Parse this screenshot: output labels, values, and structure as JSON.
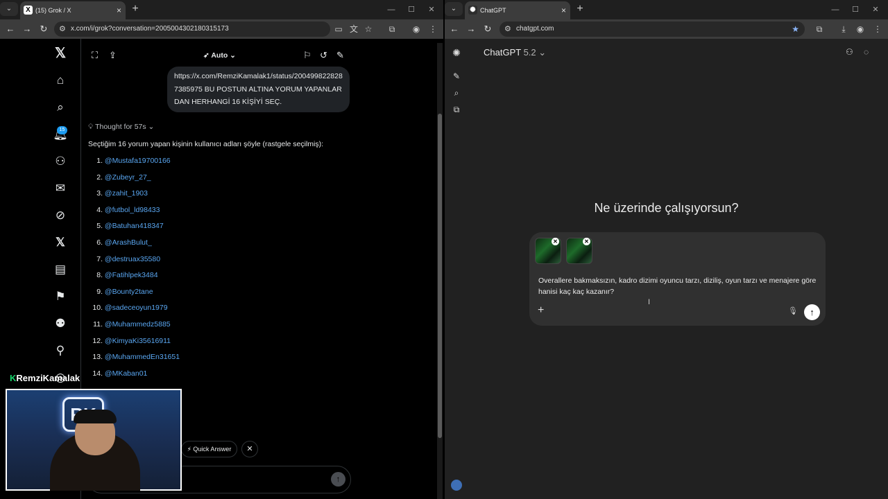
{
  "left_window": {
    "tab_title": "(15) Grok / X",
    "tab_favicon": "X",
    "url": "x.com/i/grok?conversation=2005004302180315173",
    "notification_count": "15",
    "grok": {
      "mode_label": "Auto",
      "user_message": "https://x.com/RemziKamalak1/status/2004998228287385975 BU POSTUN ALTINA YORUM YAPANLARDAN HERHANGİ 16 KİŞİYİ SEÇ.",
      "thought_label": "Thought for 57s",
      "intro": "Seçtiğim 16 yorum yapan kişinin kullanıcı adları şöyle (rastgele seçilmiş):",
      "users": [
        {
          "n": "1.",
          "handle": "@Mustafa19700166"
        },
        {
          "n": "2.",
          "handle": "@Zubeyr_27_"
        },
        {
          "n": "3.",
          "handle": "@zahit_1903"
        },
        {
          "n": "4.",
          "handle": "@futbol_ld98433"
        },
        {
          "n": "5.",
          "handle": "@Batuhan418347"
        },
        {
          "n": "6.",
          "handle": "@ArashBulut_"
        },
        {
          "n": "7.",
          "handle": "@destruax35580"
        },
        {
          "n": "8.",
          "handle": "@Fatihlpek3484"
        },
        {
          "n": "9.",
          "handle": "@Bounty2tane"
        },
        {
          "n": "10.",
          "handle": "@sadeceoyun1979"
        },
        {
          "n": "11.",
          "handle": "@Muhammedz5885"
        },
        {
          "n": "12.",
          "handle": "@KimyaKi35616911"
        },
        {
          "n": "13.",
          "handle": "@MuhammedEn31651"
        },
        {
          "n": "14.",
          "handle": "@MKaban01"
        }
      ],
      "quick_answer": "Quick Answer"
    },
    "overlay_brand_k": "K",
    "overlay_brand": "RemziKamalak"
  },
  "right_window": {
    "tab_title": "ChatGPT",
    "url": "chatgpt.com",
    "model_name": "ChatGPT",
    "model_version": "5.2",
    "headline": "Ne üzerinde çalışıyorsun?",
    "prompt_text": "Overallere bakmaksızın, kadro dizimi oyuncu tarzı, diziliş, oyun tarzı ve menajere göre hanisi kaç kaç kazanır?"
  }
}
